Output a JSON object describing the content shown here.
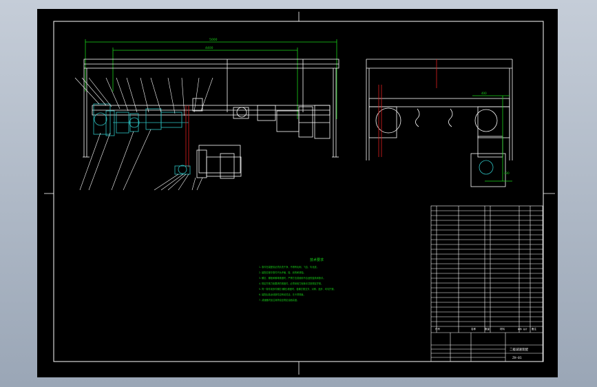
{
  "drawing": {
    "dimension_overall": "5000",
    "dimension_span": "4400",
    "dimension_side": "400",
    "dimension_side_vertical": "430",
    "notes_title": "技术要求",
    "notes": [
      "1. 零件在装配前必须清洗干净，不得有毛刺、飞边、氧化皮。",
      "2. 装配过程中零件不允许磕、碰、划伤和锈蚀。",
      "3. 螺钉、螺栓和螺母紧固时，严禁打击或使用不合适的旋具和扳手。",
      "4. 规定拧紧力矩要求的紧固件，必须采用力矩扳手并按规定拧紧。",
      "5. 同一零件用多件螺钉(螺栓)紧固时，各螺钉需交叉、对称、逐步、均匀拧紧。",
      "6. 装配后各运动部件应转动灵活，无卡滞现象。",
      "7. 减速器内加注润滑油至规定油面高度。"
    ],
    "title_block": {
      "drawing_name": "二级减速装配",
      "drawing_number": "ZH-01",
      "col_code": "代号",
      "col_name": "名称",
      "col_qty": "数量",
      "col_material": "材料",
      "col_weight": "单件 总计",
      "col_remark": "备注"
    }
  }
}
